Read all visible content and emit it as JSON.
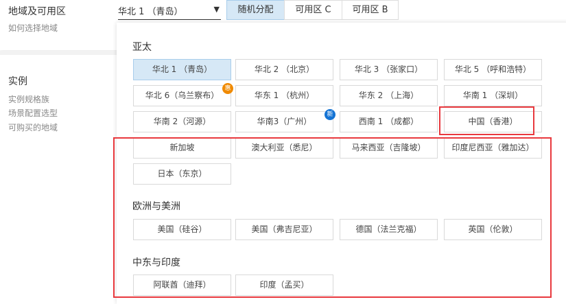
{
  "left": {
    "title": "地域及可用区",
    "help_link": "如何选择地域",
    "section": "实例",
    "items": [
      "实例规格族",
      "场景配置选型",
      "可购买的地域"
    ]
  },
  "select": {
    "value": "华北 1 （青岛）",
    "caret": "▼"
  },
  "zones": [
    "随机分配",
    "可用区 C",
    "可用区 B"
  ],
  "groups": [
    {
      "title": "亚太",
      "regions": [
        {
          "label": "华北 1 （青岛）"
        },
        {
          "label": "华北 2 （北京）"
        },
        {
          "label": "华北 3 （张家口）"
        },
        {
          "label": "华北 5 （呼和浩特）"
        },
        {
          "label": "华北 6（乌兰察布）",
          "badge": "惠"
        },
        {
          "label": "华东 1 （杭州）"
        },
        {
          "label": "华东 2 （上海）"
        },
        {
          "label": "华南 1 （深圳）"
        },
        {
          "label": "华南 2（河源）"
        },
        {
          "label": "华南3（广州）",
          "badge": "新"
        },
        {
          "label": "西南 1 （成都）"
        },
        {
          "label": "中国（香港）"
        },
        {
          "label": "新加坡"
        },
        {
          "label": "澳大利亚（悉尼）"
        },
        {
          "label": "马来西亚（吉隆坡）"
        },
        {
          "label": "印度尼西亚（雅加达）"
        },
        {
          "label": "日本（东京）"
        }
      ]
    },
    {
      "title": "欧洲与美洲",
      "regions": [
        {
          "label": "美国（硅谷）"
        },
        {
          "label": "美国（弗吉尼亚）"
        },
        {
          "label": "德国（法兰克福）"
        },
        {
          "label": "英国（伦敦）"
        }
      ]
    },
    {
      "title": "中东与印度",
      "regions": [
        {
          "label": "阿联酋（迪拜）"
        },
        {
          "label": "印度（孟买）"
        }
      ]
    }
  ],
  "colors": {
    "badge_discount": "#f08a00",
    "badge_new": "#1473d4",
    "highlight": "#e8383d",
    "selected": "#d6e8f6"
  }
}
